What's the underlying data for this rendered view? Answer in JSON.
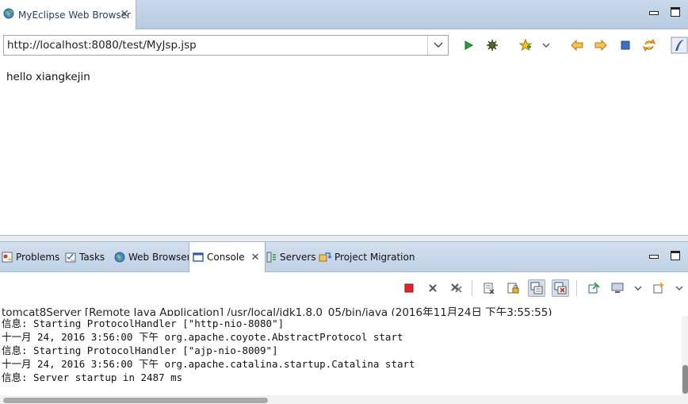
{
  "editor": {
    "tab_title": "MyEclipse Web Browser",
    "tab_icon": "globe-icon"
  },
  "browser": {
    "url": "http://localhost:8080/test/MyJsp.jsp",
    "content_text": "hello xiangkejin",
    "toolbar_icons": [
      "go-play-icon",
      "debug-gear-icon",
      "favorite-star-icon",
      "dropdown-chevron-icon",
      "back-arrow-icon",
      "forward-arrow-icon",
      "stop-square-icon",
      "refresh-icon",
      "logo-icon"
    ]
  },
  "views": {
    "tabs": [
      {
        "label": "Problems",
        "icon": "problems-icon"
      },
      {
        "label": "Tasks",
        "icon": "tasks-icon"
      },
      {
        "label": "Web Browser",
        "icon": "globe-icon"
      },
      {
        "label": "Console",
        "icon": "console-icon",
        "active": true
      },
      {
        "label": "Servers",
        "icon": "servers-icon"
      },
      {
        "label": "Project Migration",
        "icon": "migration-icon"
      }
    ]
  },
  "console": {
    "header": "tomcat8Server [Remote Java Application] /usr/local/jdk1.8.0_05/bin/java (2016年11月24日 下午3:55:55)",
    "lines": [
      "信息: Starting ProtocolHandler [\"http-nio-8080\"]",
      "十一月 24, 2016 3:56:00 下午 org.apache.coyote.AbstractProtocol start",
      "信息: Starting ProtocolHandler [\"ajp-nio-8009\"]",
      "十一月 24, 2016 3:56:00 下午 org.apache.catalina.startup.Catalina start",
      "信息: Server startup in 2487 ms"
    ]
  },
  "colors": {
    "tabbar_blue": "#c9d8ea",
    "terminate_red": "#e0242c",
    "play_green": "#2e9b3a"
  }
}
